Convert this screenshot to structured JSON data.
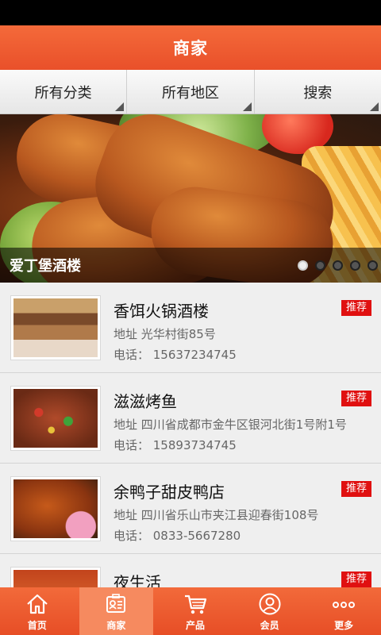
{
  "header": {
    "title": "商家"
  },
  "filters": {
    "category": "所有分类",
    "region": "所有地区",
    "search": "搜索"
  },
  "banner": {
    "caption": "爱丁堡酒楼",
    "slide_count": 5,
    "active_slide": 1
  },
  "stores": [
    {
      "name": "香饵火锅酒楼",
      "badge": "推荐",
      "address": "地址  光华村街85号",
      "phone": "电话：  15637234745"
    },
    {
      "name": "滋滋烤鱼",
      "badge": "推荐",
      "address": "地址  四川省成都市金牛区银河北街1号附1号",
      "phone": "电话：  15893734745"
    },
    {
      "name": "余鸭子甜皮鸭店",
      "badge": "推荐",
      "address": "地址  四川省乐山市夹江县迎春街108号",
      "phone": "电话：  0833-5667280"
    },
    {
      "name": "夜生活",
      "badge": "推荐",
      "address": "",
      "phone": ""
    }
  ],
  "tabbar": {
    "home": "首页",
    "merchant": "商家",
    "product": "产品",
    "member": "会员",
    "more": "更多",
    "active": "merchant"
  },
  "colors": {
    "brand": "#e9502a",
    "badge": "#e01010",
    "active_tab": "#f68a5f"
  }
}
